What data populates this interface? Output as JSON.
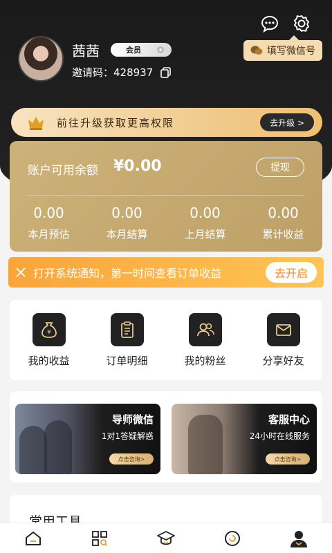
{
  "header": {
    "username": "茜茜",
    "member_badge": "会员",
    "invite_label": "邀请码：428937",
    "wechat_button": "填写微信号",
    "icons": [
      "message-icon",
      "gear-icon"
    ]
  },
  "upgrade": {
    "text": "前往升级获取更高权限",
    "button": "去升级 >"
  },
  "balance": {
    "label": "账户可用余额",
    "value": "¥0.00",
    "withdraw": "提现",
    "stats": [
      {
        "value": "0.00",
        "label": "本月预估"
      },
      {
        "value": "0.00",
        "label": "本月结算"
      },
      {
        "value": "0.00",
        "label": "上月结算"
      },
      {
        "value": "0.00",
        "label": "累计收益"
      }
    ]
  },
  "notice": {
    "text": "打开系统通知，第一时间查看订单收益",
    "button": "去开启"
  },
  "grid": [
    {
      "label": "我的收益",
      "icon": "money-bag-icon"
    },
    {
      "label": "订单明细",
      "icon": "clipboard-icon"
    },
    {
      "label": "我的粉丝",
      "icon": "users-icon"
    },
    {
      "label": "分享好友",
      "icon": "envelope-icon"
    }
  ],
  "promos": [
    {
      "title": "导师微信",
      "subtitle": "1对1答疑解惑",
      "button": "点击咨询>"
    },
    {
      "title": "客服中心",
      "subtitle": "24小时在线服务",
      "button": "点击咨询>"
    }
  ],
  "tools": {
    "title": "常用工具"
  },
  "tabbar": [
    "home-icon",
    "grid-search-icon",
    "graduation-cap-icon",
    "refresh-circle-icon",
    "profile-icon"
  ],
  "colors": {
    "gold": "#c8ad72",
    "orange": "#f9a53a",
    "dark": "#1a1a1a"
  }
}
